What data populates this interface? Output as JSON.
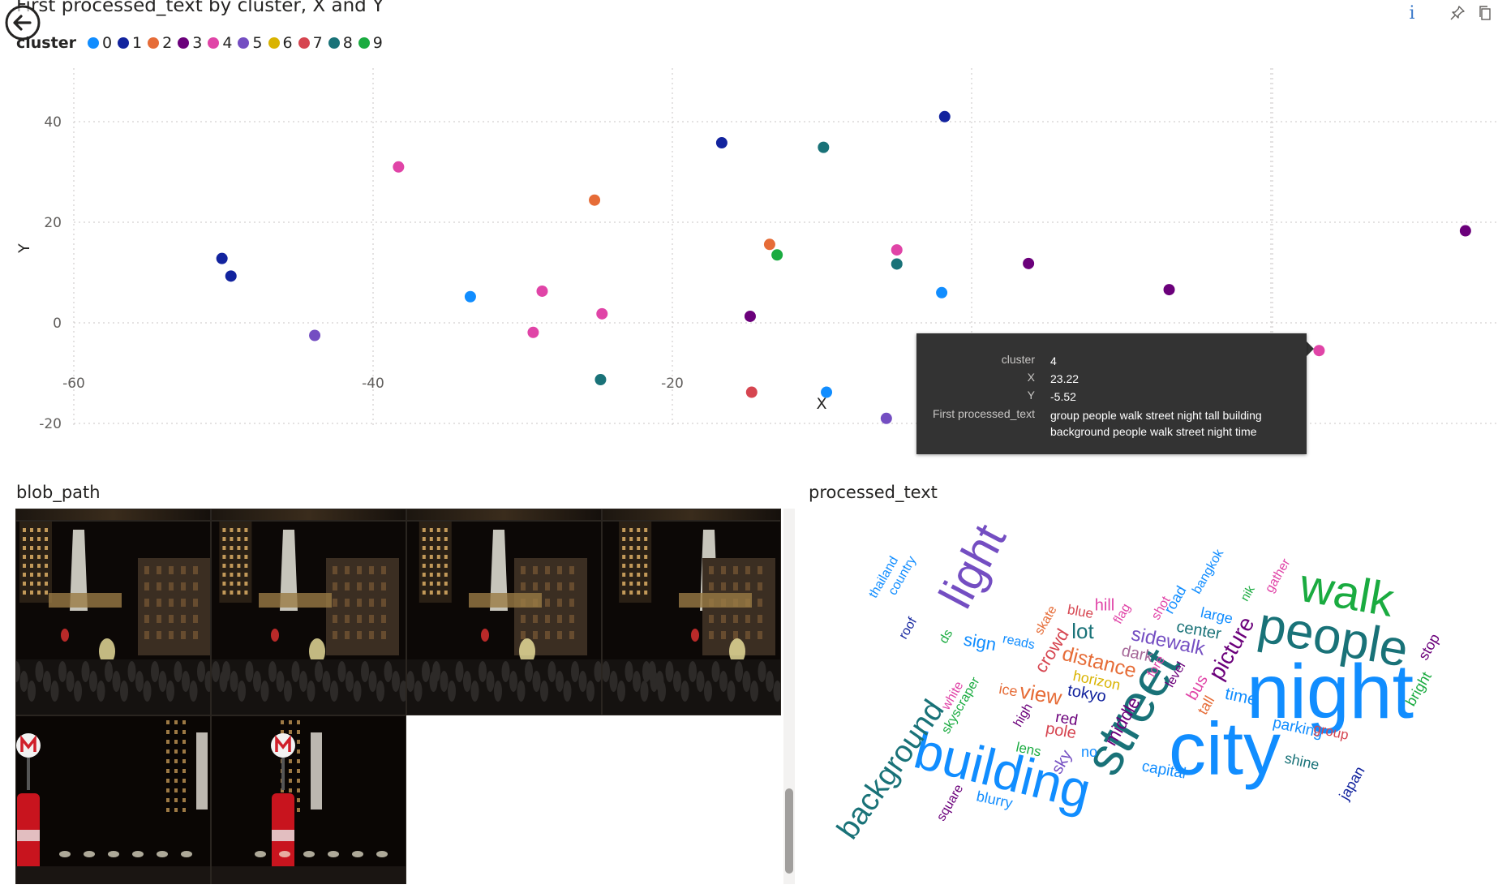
{
  "visual_title": "First processed_text by cluster, X and Y",
  "legend": {
    "title": "cluster",
    "items": [
      {
        "label": "0",
        "color": "#118DFF"
      },
      {
        "label": "1",
        "color": "#12239E"
      },
      {
        "label": "2",
        "color": "#E66C37"
      },
      {
        "label": "3",
        "color": "#6B007B"
      },
      {
        "label": "4",
        "color": "#E044A7"
      },
      {
        "label": "5",
        "color": "#744EC2"
      },
      {
        "label": "6",
        "color": "#D9B300"
      },
      {
        "label": "7",
        "color": "#D64550"
      },
      {
        "label": "8",
        "color": "#197278"
      },
      {
        "label": "9",
        "color": "#1AAB40"
      }
    ]
  },
  "chart_data": {
    "type": "scatter",
    "xlabel": "X",
    "ylabel": "Y",
    "xlim": [
      -60,
      30
    ],
    "ylim": [
      -21,
      49
    ],
    "xticks": [
      -60,
      -40,
      -20,
      0,
      20
    ],
    "yticks": [
      -20,
      0,
      20,
      40
    ],
    "grid": true,
    "legend_position": "top-left",
    "points": [
      {
        "x": -50.1,
        "y": 12.8,
        "cluster": "1"
      },
      {
        "x": -49.5,
        "y": 9.3,
        "cluster": "1"
      },
      {
        "x": -43.9,
        "y": -2.5,
        "cluster": "5"
      },
      {
        "x": -38.3,
        "y": 31.0,
        "cluster": "4"
      },
      {
        "x": -33.5,
        "y": 5.2,
        "cluster": "0"
      },
      {
        "x": -28.7,
        "y": 6.3,
        "cluster": "4"
      },
      {
        "x": -29.3,
        "y": -1.9,
        "cluster": "4"
      },
      {
        "x": -25.2,
        "y": 24.4,
        "cluster": "2"
      },
      {
        "x": -24.7,
        "y": 1.8,
        "cluster": "4"
      },
      {
        "x": -24.8,
        "y": -11.3,
        "cluster": "8"
      },
      {
        "x": -16.7,
        "y": 35.8,
        "cluster": "1"
      },
      {
        "x": -14.8,
        "y": 1.3,
        "cluster": "3"
      },
      {
        "x": -14.7,
        "y": -13.8,
        "cluster": "7"
      },
      {
        "x": -13.5,
        "y": 15.6,
        "cluster": "2"
      },
      {
        "x": -13.0,
        "y": 13.5,
        "cluster": "9"
      },
      {
        "x": -9.9,
        "y": 34.9,
        "cluster": "8"
      },
      {
        "x": -9.7,
        "y": -13.8,
        "cluster": "0"
      },
      {
        "x": -5.7,
        "y": -19.0,
        "cluster": "5"
      },
      {
        "x": -5.0,
        "y": 14.5,
        "cluster": "4"
      },
      {
        "x": -5.0,
        "y": 11.7,
        "cluster": "8"
      },
      {
        "x": -2.0,
        "y": 6.0,
        "cluster": "0"
      },
      {
        "x": -1.8,
        "y": 41.0,
        "cluster": "1"
      },
      {
        "x": 3.8,
        "y": 11.8,
        "cluster": "3"
      },
      {
        "x": 13.2,
        "y": 6.6,
        "cluster": "3"
      },
      {
        "x": 23.22,
        "y": -5.52,
        "cluster": "4"
      },
      {
        "x": 33.0,
        "y": 18.3,
        "cluster": "3"
      }
    ]
  },
  "tooltip": {
    "rows": [
      {
        "key": "cluster",
        "value": "4"
      },
      {
        "key": "X",
        "value": "23.22"
      },
      {
        "key": "Y",
        "value": "-5.52"
      },
      {
        "key": "First processed_text",
        "value": "group people walk street night tall building background people walk street night time"
      }
    ]
  },
  "image_panel": {
    "title": "blob_path",
    "thumbnails": [
      {
        "name": "night-street-photo-1",
        "scene": "tower"
      },
      {
        "name": "night-street-photo-2",
        "scene": "tower"
      },
      {
        "name": "night-street-photo-3",
        "scene": "tower"
      },
      {
        "name": "night-street-photo-4",
        "scene": "tower"
      },
      {
        "name": "metro-sign-photo-1",
        "scene": "metro"
      },
      {
        "name": "metro-sign-photo-2",
        "scene": "metro"
      }
    ]
  },
  "wordcloud_panel": {
    "title": "processed_text",
    "words": [
      {
        "text": "night",
        "color": "#118DFF",
        "size": 95,
        "rotate": 0
      },
      {
        "text": "city",
        "color": "#118DFF",
        "size": 92,
        "rotate": 0
      },
      {
        "text": "street",
        "color": "#197278",
        "size": 66,
        "rotate": -60
      },
      {
        "text": "building",
        "color": "#118DFF",
        "size": 64,
        "rotate": 14
      },
      {
        "text": "people",
        "color": "#197278",
        "size": 62,
        "rotate": 10
      },
      {
        "text": "walk",
        "color": "#1AAB40",
        "size": 58,
        "rotate": 10
      },
      {
        "text": "light",
        "color": "#744EC2",
        "size": 58,
        "rotate": -62
      },
      {
        "text": "background",
        "color": "#197278",
        "size": 38,
        "rotate": -55
      },
      {
        "text": "picture",
        "color": "#6B007B",
        "size": 28,
        "rotate": -60
      },
      {
        "text": "distance",
        "color": "#E66C37",
        "size": 25,
        "rotate": 14
      },
      {
        "text": "sidewalk",
        "color": "#744EC2",
        "size": 24,
        "rotate": 12
      },
      {
        "text": "view",
        "color": "#E66C37",
        "size": 26,
        "rotate": 10
      },
      {
        "text": "lot",
        "color": "#197278",
        "size": 26,
        "rotate": 0
      },
      {
        "text": "crowd",
        "color": "#D64550",
        "size": 22,
        "rotate": -58
      },
      {
        "text": "middle",
        "color": "#6B007B",
        "size": 22,
        "rotate": -60
      },
      {
        "text": "sign",
        "color": "#118DFF",
        "size": 22,
        "rotate": 10
      },
      {
        "text": "tokyo",
        "color": "#12239E",
        "size": 20,
        "rotate": 10
      },
      {
        "text": "time",
        "color": "#118DFF",
        "size": 21,
        "rotate": 12
      },
      {
        "text": "pole",
        "color": "#D64550",
        "size": 20,
        "rotate": 10
      },
      {
        "text": "capital",
        "color": "#118DFF",
        "size": 19,
        "rotate": 10
      },
      {
        "text": "center",
        "color": "#197278",
        "size": 20,
        "rotate": 10
      },
      {
        "text": "parking",
        "color": "#118DFF",
        "size": 19,
        "rotate": 12
      },
      {
        "text": "dark",
        "color": "#A66999",
        "size": 20,
        "rotate": 12
      },
      {
        "text": "horizon",
        "color": "#D9B300",
        "size": 18,
        "rotate": 12
      },
      {
        "text": "red",
        "color": "#6B007B",
        "size": 19,
        "rotate": 10
      },
      {
        "text": "ice",
        "color": "#E66C37",
        "size": 18,
        "rotate": 10
      },
      {
        "text": "hill",
        "color": "#E044A7",
        "size": 20,
        "rotate": 0
      },
      {
        "text": "blue",
        "color": "#D64550",
        "size": 17,
        "rotate": 10
      },
      {
        "text": "flag",
        "color": "#E044A7",
        "size": 16,
        "rotate": -60
      },
      {
        "text": "skate",
        "color": "#E66C37",
        "size": 16,
        "rotate": -60
      },
      {
        "text": "reads",
        "color": "#118DFF",
        "size": 16,
        "rotate": 12
      },
      {
        "text": "ds",
        "color": "#1AAB40",
        "size": 16,
        "rotate": -60
      },
      {
        "text": "roof",
        "color": "#12239E",
        "size": 16,
        "rotate": -60
      },
      {
        "text": "thailand",
        "color": "#118DFF",
        "size": 16,
        "rotate": -60
      },
      {
        "text": "country",
        "color": "#118DFF",
        "size": 16,
        "rotate": -60
      },
      {
        "text": "bangkok",
        "color": "#118DFF",
        "size": 16,
        "rotate": -60
      },
      {
        "text": "shot",
        "color": "#E044A7",
        "size": 16,
        "rotate": -60
      },
      {
        "text": "road",
        "color": "#118DFF",
        "size": 18,
        "rotate": -60
      },
      {
        "text": "large",
        "color": "#118DFF",
        "size": 18,
        "rotate": 12
      },
      {
        "text": "nik",
        "color": "#1AAB40",
        "size": 15,
        "rotate": -60
      },
      {
        "text": "gather",
        "color": "#E044A7",
        "size": 16,
        "rotate": -60
      },
      {
        "text": "stop",
        "color": "#6B007B",
        "size": 18,
        "rotate": -60
      },
      {
        "text": "bright",
        "color": "#1AAB40",
        "size": 18,
        "rotate": -60
      },
      {
        "text": "group",
        "color": "#D64550",
        "size": 17,
        "rotate": 12
      },
      {
        "text": "shine",
        "color": "#197278",
        "size": 18,
        "rotate": 12
      },
      {
        "text": "japan",
        "color": "#12239E",
        "size": 18,
        "rotate": -60
      },
      {
        "text": "white",
        "color": "#E044A7",
        "size": 16,
        "rotate": -60
      },
      {
        "text": "skyscraper",
        "color": "#1AAB40",
        "size": 16,
        "rotate": -60
      },
      {
        "text": "high",
        "color": "#6B007B",
        "size": 16,
        "rotate": -60
      },
      {
        "text": "sky",
        "color": "#744EC2",
        "size": 20,
        "rotate": -60
      },
      {
        "text": "no",
        "color": "#118DFF",
        "size": 18,
        "rotate": 0
      },
      {
        "text": "lens",
        "color": "#1AAB40",
        "size": 17,
        "rotate": 12
      },
      {
        "text": "square",
        "color": "#6B007B",
        "size": 16,
        "rotate": -60
      },
      {
        "text": "blurry",
        "color": "#118DFF",
        "size": 18,
        "rotate": 12
      },
      {
        "text": "bus",
        "color": "#E044A7",
        "size": 20,
        "rotate": -60
      },
      {
        "text": "tall",
        "color": "#E66C37",
        "size": 18,
        "rotate": -60
      },
      {
        "text": "level",
        "color": "#6B007B",
        "size": 16,
        "rotate": -60
      },
      {
        "text": "fore",
        "color": "#E044A7",
        "size": 16,
        "rotate": -60
      }
    ]
  },
  "toolbar": {
    "info_label": "i",
    "pin_icon": "pin-icon",
    "copy_icon": "copy-icon",
    "back_icon": "back-arrow-icon"
  }
}
